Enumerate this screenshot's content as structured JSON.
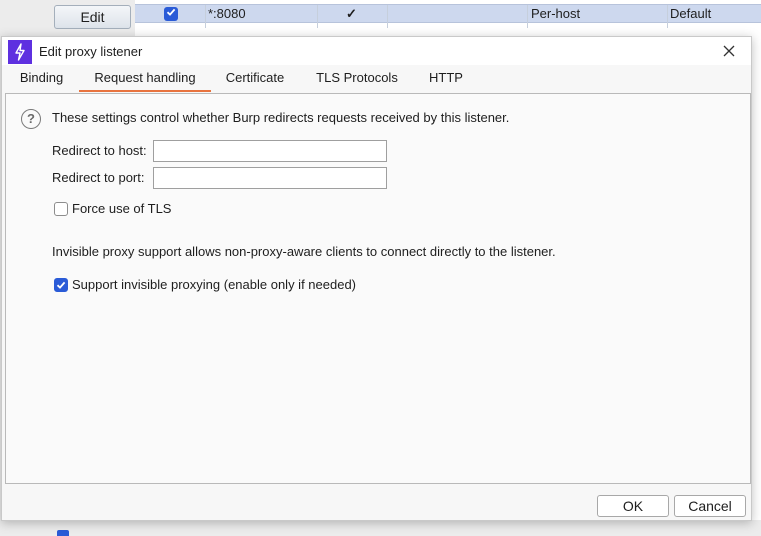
{
  "background": {
    "edit_label": "Edit",
    "row": {
      "checked": true,
      "interface": "*:8080",
      "invisible_mark": "✓",
      "certificate": "Per-host",
      "tls": "Default"
    }
  },
  "dialog": {
    "title": "Edit proxy listener",
    "tabs": [
      {
        "label": "Binding",
        "active": false
      },
      {
        "label": "Request handling",
        "active": true
      },
      {
        "label": "Certificate",
        "active": false
      },
      {
        "label": "TLS Protocols",
        "active": false
      },
      {
        "label": "HTTP",
        "active": false
      }
    ],
    "description": "These settings control whether Burp redirects requests received by this listener.",
    "redirect_host": {
      "label": "Redirect to host:",
      "value": ""
    },
    "redirect_port": {
      "label": "Redirect to port:",
      "value": ""
    },
    "force_tls": {
      "label": "Force use of TLS",
      "checked": false
    },
    "invisible_info": "Invisible proxy support allows non-proxy-aware clients to connect directly to the listener.",
    "invisible_proxy": {
      "label": "Support invisible proxying (enable only if needed)",
      "checked": true
    },
    "ok_label": "OK",
    "cancel_label": "Cancel"
  },
  "colors": {
    "accent_tab": "#e8733f",
    "checkbox_checked": "#2a5bd7",
    "app_icon": "#5e30e0",
    "selected_row": "#cdd8ee"
  }
}
